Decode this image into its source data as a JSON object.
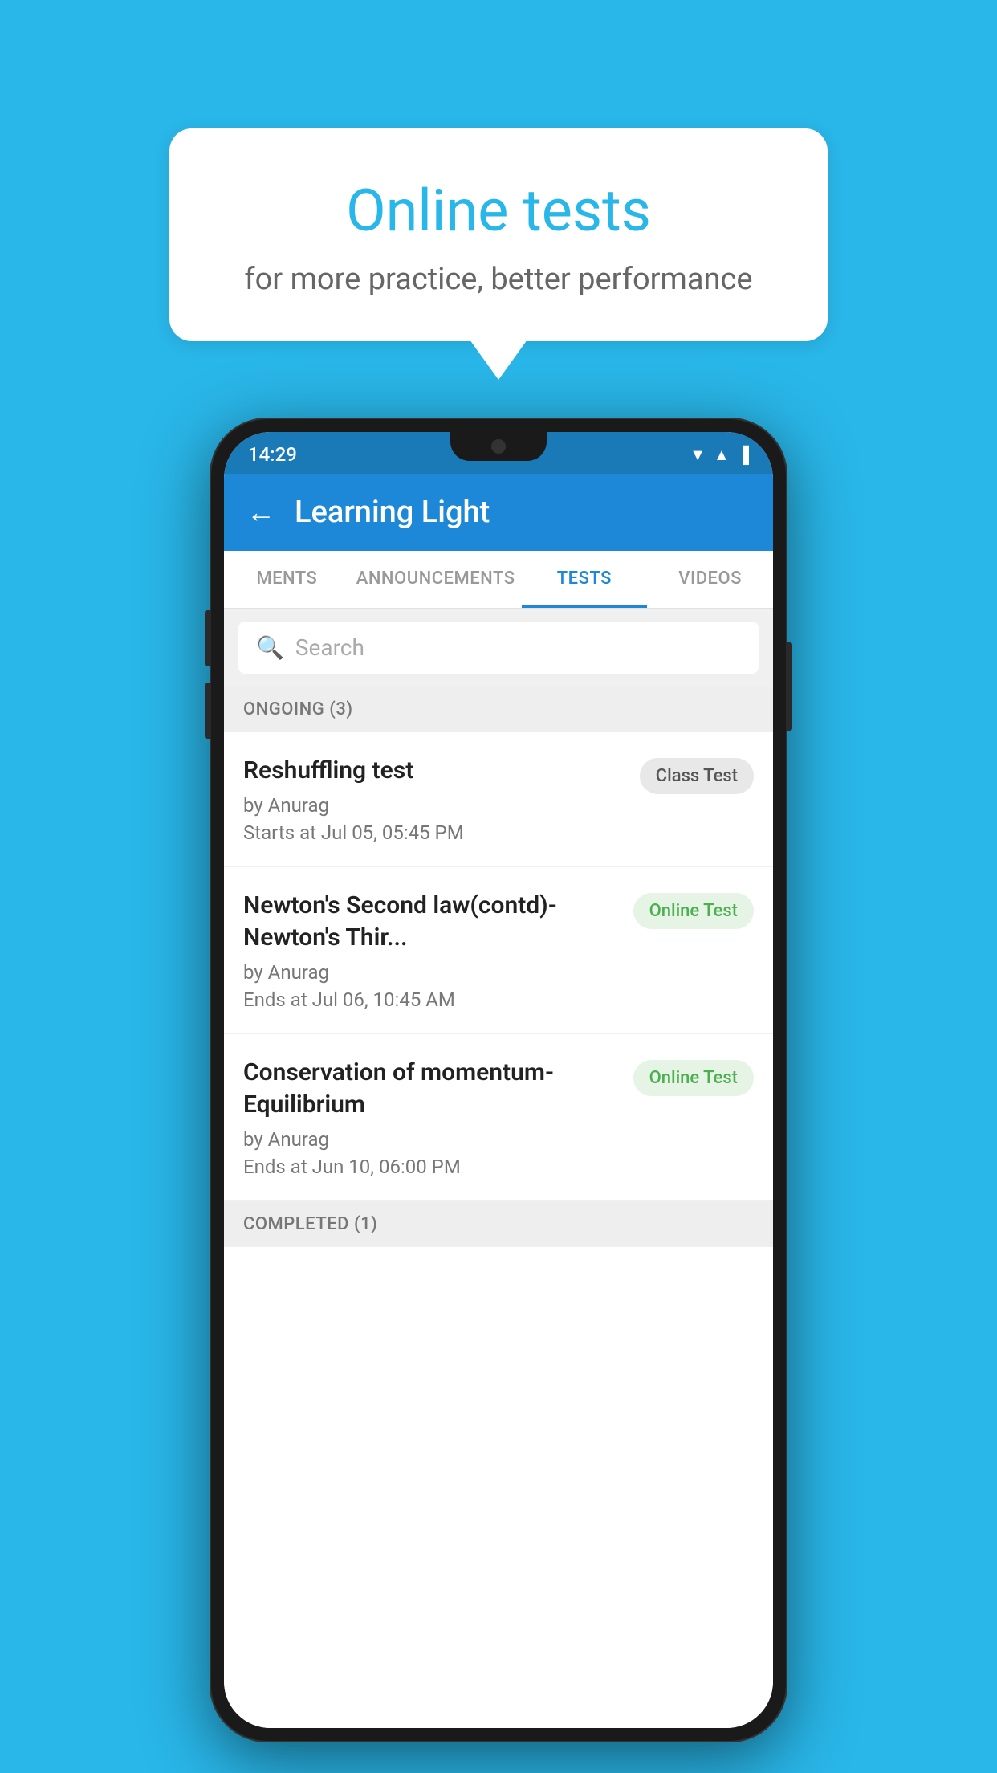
{
  "background": {
    "color": "#29b6e8"
  },
  "speech_bubble": {
    "title": "Online tests",
    "subtitle": "for more practice, better performance"
  },
  "phone": {
    "status_bar": {
      "time": "14:29",
      "icons": [
        "wifi",
        "signal",
        "battery"
      ]
    },
    "app_bar": {
      "back_label": "←",
      "title": "Learning Light"
    },
    "tabs": [
      {
        "label": "MENTS",
        "active": false
      },
      {
        "label": "ANNOUNCEMENTS",
        "active": false
      },
      {
        "label": "TESTS",
        "active": true
      },
      {
        "label": "VIDEOS",
        "active": false
      }
    ],
    "search": {
      "placeholder": "Search",
      "icon": "search"
    },
    "ongoing_section": {
      "label": "ONGOING (3)"
    },
    "tests": [
      {
        "title": "Reshuffling test",
        "author": "by Anurag",
        "date": "Starts at  Jul 05, 05:45 PM",
        "badge": "Class Test",
        "badge_type": "class"
      },
      {
        "title": "Newton's Second law(contd)-Newton's Thir...",
        "author": "by Anurag",
        "date": "Ends at  Jul 06, 10:45 AM",
        "badge": "Online Test",
        "badge_type": "online"
      },
      {
        "title": "Conservation of momentum-Equilibrium",
        "author": "by Anurag",
        "date": "Ends at  Jun 10, 06:00 PM",
        "badge": "Online Test",
        "badge_type": "online"
      }
    ],
    "completed_section": {
      "label": "COMPLETED (1)"
    }
  }
}
